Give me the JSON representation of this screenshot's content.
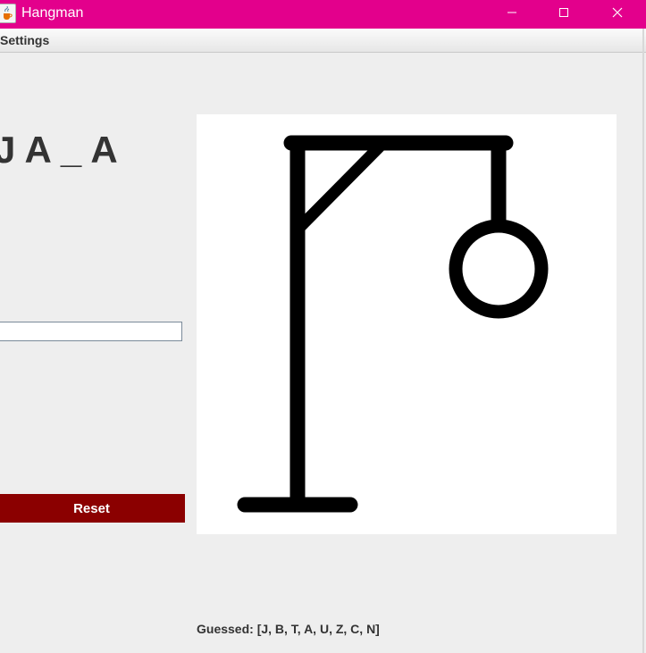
{
  "window": {
    "title": "Hangman",
    "app_icon": "java-cup-icon",
    "controls": [
      "minimize-icon",
      "maximize-icon",
      "close-icon"
    ],
    "titlebar_color": "#e3008c"
  },
  "menu": {
    "items": [
      {
        "label": "Settings"
      }
    ]
  },
  "game": {
    "word_display": "J A _ A",
    "guess_input": {
      "value": "",
      "placeholder": ""
    },
    "reset_label": "Reset",
    "reset_color": "#8b0000",
    "guessed_text": "Guessed: [J, B, T, A, U, Z, C, N]",
    "drawing": {
      "parts_shown": [
        "base",
        "pole",
        "beam",
        "brace",
        "rope",
        "head"
      ]
    }
  }
}
